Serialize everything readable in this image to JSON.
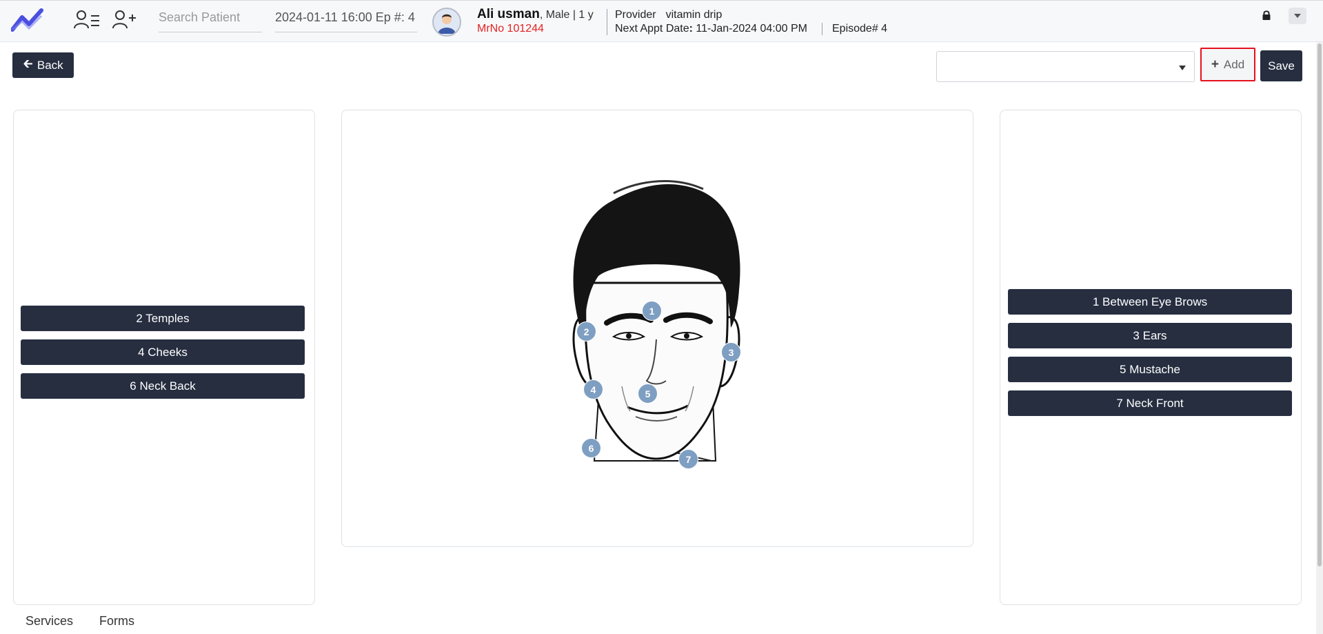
{
  "header": {
    "search_placeholder": "Search Patient",
    "episode_select": "2024-01-11 16:00 Ep #: 4",
    "patient_name": "Ali usman",
    "patient_meta": ", Male | 1 y",
    "mrno": "MrNo 101244",
    "provider_label": "Provider",
    "provider_value": "vitamin drip",
    "next_appt_label": "Next Appt Date",
    "next_appt_sep": ":",
    "next_appt_value": "11-Jan-2024 04:00 PM",
    "episode_number": "Episode# 4",
    "icons": [
      "analytics-logo-icon",
      "patient-list-icon",
      "add-patient-icon",
      "avatar-icon",
      "lock-icon",
      "chevron-down-icon"
    ]
  },
  "toolbar": {
    "back_label": "Back",
    "select_value": "",
    "add_label": "Add",
    "save_label": "Save"
  },
  "left_zones": [
    "2 Temples",
    "4 Cheeks",
    "6 Neck Back"
  ],
  "right_zones": [
    "1 Between Eye Brows",
    "3 Ears",
    "5 Mustache",
    "7 Neck Front"
  ],
  "markers": [
    "1",
    "2",
    "3",
    "4",
    "5",
    "6",
    "7"
  ],
  "tabs": [
    "Services",
    "Forms"
  ],
  "colors": {
    "primary_dark": "#262e40",
    "marker": "#7e9fc2",
    "mrno": "#e52222",
    "highlight_border": "#e5101c",
    "logo": "#4a4fe0"
  }
}
